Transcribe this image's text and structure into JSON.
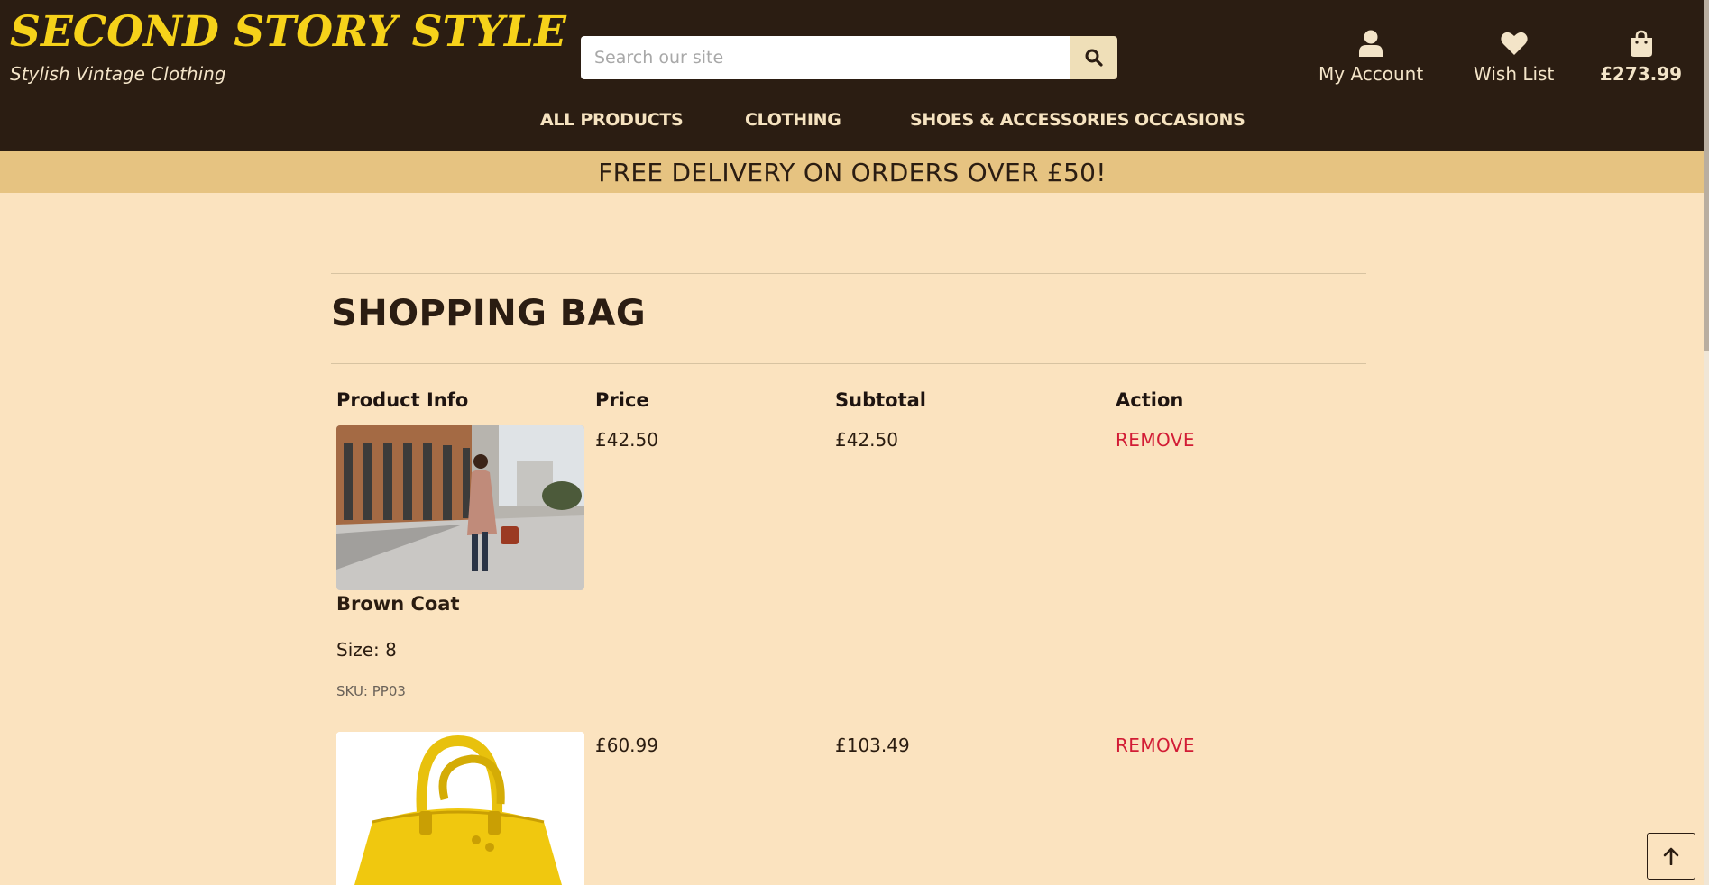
{
  "brand": {
    "name": "SECOND STORY STYLE",
    "tagline": "Stylish Vintage Clothing"
  },
  "search": {
    "placeholder": "Search our site"
  },
  "top_links": {
    "account": "My Account",
    "wishlist": "Wish List",
    "bag_total": "£273.99"
  },
  "nav": [
    "ALL PRODUCTS",
    "CLOTHING",
    "SHOES & ACCESSORIES",
    "OCCASIONS"
  ],
  "banner": "FREE DELIVERY ON ORDERS OVER £50!",
  "page": {
    "title": "SHOPPING BAG"
  },
  "table": {
    "headers": [
      "Product Info",
      "Price",
      "Subtotal",
      "Action"
    ],
    "rows": [
      {
        "name": "Brown Coat",
        "size": "Size: 8",
        "sku": "SKU: PP03",
        "price": "£42.50",
        "subtotal": "£42.50",
        "action": "REMOVE"
      },
      {
        "price": "£60.99",
        "subtotal": "£103.49",
        "action": "REMOVE"
      }
    ]
  },
  "colors": {
    "header_bg": "#2b1d12",
    "logo": "#f6d21a",
    "banner": "#e6c381",
    "page_bg": "#fbe3bf",
    "remove": "#d21c35"
  },
  "icons": [
    "search-icon",
    "user-icon",
    "heart-icon",
    "shopping-bag-icon",
    "arrow-up-icon"
  ]
}
